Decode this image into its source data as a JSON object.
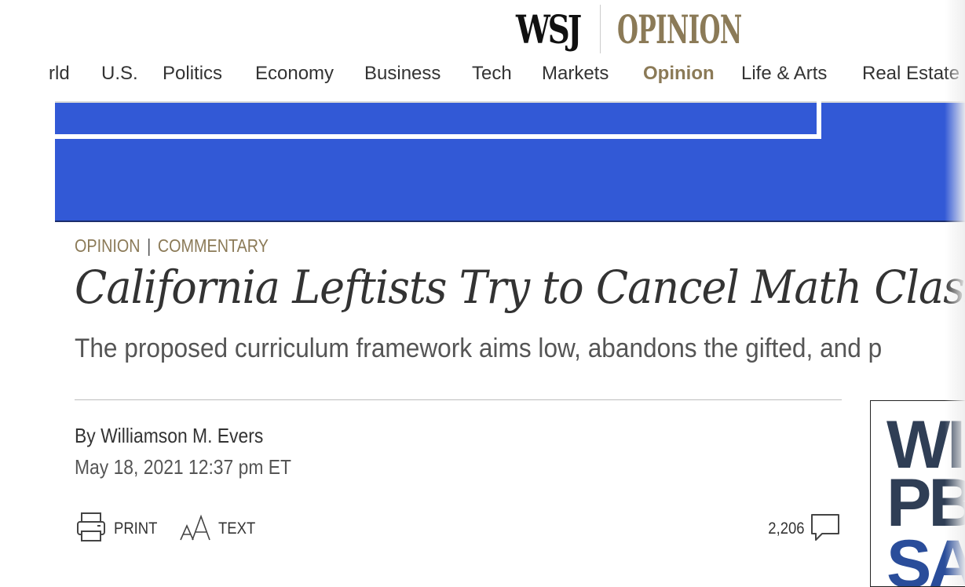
{
  "masthead": {
    "brand": "WSJ",
    "section": "OPINION"
  },
  "nav": {
    "items": [
      {
        "label": "rld",
        "active": false
      },
      {
        "label": "U.S.",
        "active": false
      },
      {
        "label": "Politics",
        "active": false
      },
      {
        "label": "Economy",
        "active": false
      },
      {
        "label": "Business",
        "active": false
      },
      {
        "label": "Tech",
        "active": false
      },
      {
        "label": "Markets",
        "active": false
      },
      {
        "label": "Opinion",
        "active": true
      },
      {
        "label": "Life & Arts",
        "active": false
      },
      {
        "label": "Real Estate",
        "active": false
      }
    ]
  },
  "colors": {
    "accent": "#8b7a57",
    "banner": "#3259d6"
  },
  "article": {
    "kicker_section": "OPINION",
    "kicker_separator": "|",
    "kicker_type": "COMMENTARY",
    "headline": "California Leftists Try to Cancel Math Class",
    "dek": "The proposed curriculum framework aims low, abandons the gifted, and p",
    "byline_prefix": "By",
    "author": "Williamson M. Evers",
    "timestamp": "May 18, 2021 12:37 pm ET"
  },
  "tools": {
    "print_label": "PRINT",
    "print_icon": "printer-icon",
    "text_label": "TEXT",
    "text_icon": "text-size-icon",
    "comment_count": "2,206",
    "comment_icon": "speech-bubble-icon"
  },
  "ad": {
    "line1": "WI",
    "line2": "PB",
    "line3": "SA"
  }
}
